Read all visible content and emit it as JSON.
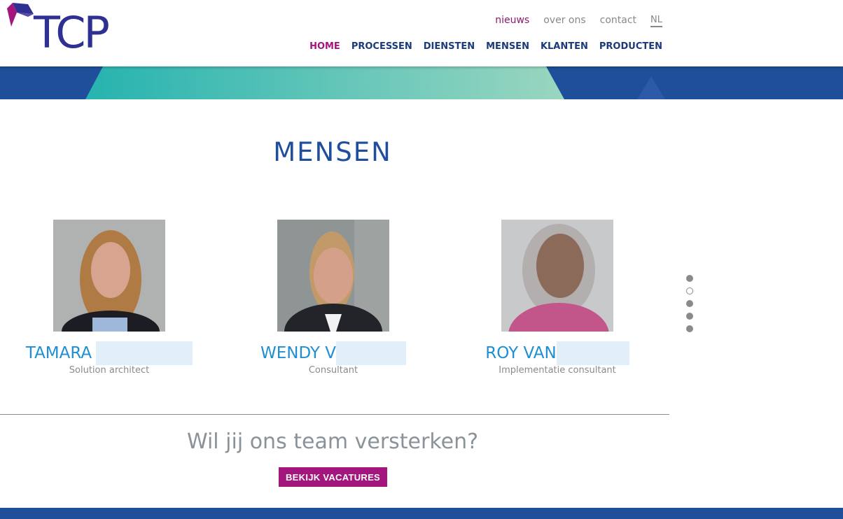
{
  "brand": {
    "logo_text": "TCP"
  },
  "top_links": [
    {
      "label": "nieuws"
    },
    {
      "label": "over ons"
    },
    {
      "label": "contact"
    },
    {
      "label": "NL"
    }
  ],
  "main_nav": [
    {
      "label": "HOME",
      "active": true
    },
    {
      "label": "PROCESSEN"
    },
    {
      "label": "DIENSTEN"
    },
    {
      "label": "MENSEN"
    },
    {
      "label": "KLANTEN"
    },
    {
      "label": "PRODUCTEN"
    }
  ],
  "page": {
    "title": "MENSEN"
  },
  "people": [
    {
      "name": "TAMARA",
      "role": "Solution architect"
    },
    {
      "name": "WENDY V",
      "role": "Consultant"
    },
    {
      "name": "ROY VAN",
      "role": "Implementatie consultant"
    }
  ],
  "carousel": {
    "dot_count": 5,
    "active_index": 1
  },
  "cta": {
    "text": "Wil jij ons team versterken?",
    "button_label": "BEKIJK VACATURES"
  },
  "colors": {
    "brand_blue": "#2e3192",
    "nav_active": "#a3167e",
    "name_blue": "#1e8fd4",
    "banner_blue": "#1f4e9a",
    "banner_teal": "#7fcdbb"
  }
}
